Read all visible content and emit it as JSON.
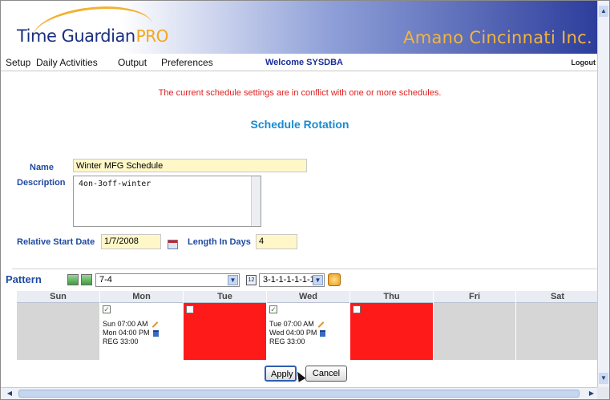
{
  "app": {
    "logo_main": "Time Guardian",
    "logo_pro": "PRO",
    "company": "Amano Cincinnati Inc."
  },
  "menu": {
    "items": [
      "Setup",
      "Daily Activities",
      "Output",
      "Preferences"
    ],
    "welcome": "Welcome SYSDBA",
    "logout": "Logout"
  },
  "conflict_message": "The current schedule settings are in conflict with one or more schedules.",
  "page_title": "Schedule Rotation",
  "form": {
    "name_label": "Name",
    "name_value": "Winter MFG Schedule",
    "description_label": "Description",
    "description_value": "4on-3off-winter",
    "start_label": "Relative Start Date",
    "start_value": "1/7/2008",
    "length_label": "Length In Days",
    "length_value": "4"
  },
  "pattern": {
    "label": "Pattern",
    "selected": "7-4",
    "sequence": "3-1-1-1-1-1-1",
    "days": [
      {
        "name": "Sun",
        "state": "gray"
      },
      {
        "name": "Mon",
        "state": "white",
        "checked": true,
        "start": "Sun 07:00 AM",
        "end": "Mon 04:00 PM",
        "code": "REG 33:00"
      },
      {
        "name": "Tue",
        "state": "red",
        "checked": false
      },
      {
        "name": "Wed",
        "state": "white",
        "checked": true,
        "start": "Tue 07:00 AM",
        "end": "Wed 04:00 PM",
        "code": "REG 33:00"
      },
      {
        "name": "Thu",
        "state": "red",
        "checked": false
      },
      {
        "name": "Fri",
        "state": "gray"
      },
      {
        "name": "Sat",
        "state": "gray"
      }
    ]
  },
  "buttons": {
    "apply": "Apply",
    "cancel": "Cancel"
  },
  "colors": {
    "title": "#1a8ad0",
    "label": "#1f4aa0",
    "conflict": "#e02020",
    "red_day": "#ff1a1a",
    "gray_day": "#d6d6d6"
  }
}
